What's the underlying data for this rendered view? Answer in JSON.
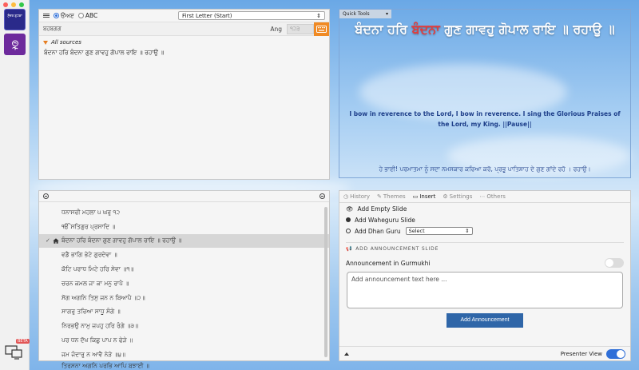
{
  "search": {
    "script_options": [
      "ੳਅੲ",
      "ABC"
    ],
    "selected_script": "ੳਅੲ",
    "search_type": "First Letter (Start)",
    "query": "ਬਹਬਗਗ",
    "ang_label": "Ang",
    "ang_placeholder": "੧੨੩",
    "sources_label": "All sources",
    "results": [
      "ਬੰਦਨਾ ਹਰਿ ਬੰਦਨਾ ਗੁਣ ਗਾਵਹੁ ਗੋਪਾਲ ਰਾਇ ॥ ਰਹਾਉ ॥"
    ]
  },
  "shabad": {
    "lines": [
      "ਧਨਾਸਰੀ ਮਹਲਾ ੫ ਘਰੁ ੧੨",
      "ੴ ਸਤਿਗੁਰ ਪ੍ਰਸਾਦਿ ॥",
      "ਬੰਦਨਾ ਹਰਿ ਬੰਦਨਾ ਗੁਣ ਗਾਵਹੁ ਗੋਪਾਲ ਰਾਇ ॥ ਰਹਾਉ ॥",
      "ਵਡੈ ਭਾਗਿ ਭੇਟੇ ਗੁਰਦੇਵਾ ॥",
      "ਕੋਟਿ ਪਰਾਧ ਮਿਟੇ ਹਰਿ ਸੇਵਾ ॥੧॥",
      "ਚਰਨ ਕਮਲ ਜਾ ਕਾ ਮਨੁ ਰਾਪੈ ॥",
      "ਸੋਗ ਅਗਨਿ ਤਿਸੁ ਜਨ ਨ ਬਿਆਪੈ ॥੨॥",
      "ਸਾਗਰੁ ਤਰਿਆ ਸਾਧੂ ਸੰਗੇ ॥",
      "ਨਿਰਭਉ ਨਾਮੁ ਜਪਹੁ ਹਰਿ ਰੰਗੇ ॥੩॥",
      "ਪਰ ਧਨ ਦੋਖ ਕਿਛੁ ਪਾਪ ਨ ਫੇੜੇ ॥",
      "ਜਮ ਜੰਦਾਰੁ ਨ ਆਵੈ ਨੇੜੇ ॥੪॥",
      "ਤ੍ਰਿਸਨਾ ਅਗਨਿ ਪ੍ਰਭਿ ਆਪਿ ਬੁਝਾਈ ॥"
    ],
    "current_index": 2
  },
  "preview": {
    "quick_tools_label": "Quick Tools",
    "gurbani_parts": [
      {
        "text": "ਬੰਦਨਾ ਹਰਿ ",
        "highlight": false
      },
      {
        "text": "ਬੰਦਨਾ",
        "highlight": true
      },
      {
        "text": " ਗੁਣ ਗਾਵਹੁ ਗੋਪਾਲ ਰਾਇ ॥ ਰਹਾਉ ॥",
        "highlight": false
      }
    ],
    "translation": "I bow in reverence to the Lord, I bow in reverence. I sing the Glorious Praises of the Lord, my King. ||Pause||",
    "teeka": "ਹੇ ਭਾਈ! ਪਰਮਾਤਮਾ ਨੂੰ ਸਦਾ ਨਮਸਕਾਰ ਕਰਿਆ ਕਰੋ, ਪ੍ਰਭੂ ਪਾਤਿਸ਼ਾਹ ਦੇ ਗੁਣ ਗਾਂਦੇ ਰਹੋ । ਰਹਾਉ।"
  },
  "tools": {
    "tabs": [
      {
        "label": "History",
        "icon": "clock-icon",
        "active": false
      },
      {
        "label": "Themes",
        "icon": "brush-icon",
        "active": false
      },
      {
        "label": "Insert",
        "icon": "monitor-icon",
        "active": true
      },
      {
        "label": "Settings",
        "icon": "gear-icon",
        "active": false
      },
      {
        "label": "Others",
        "icon": "dots-icon",
        "active": false
      }
    ],
    "insert_empty": "Add Empty Slide",
    "insert_waheguru": "Add Waheguru Slide",
    "insert_dhan_guru": "Add Dhan Guru",
    "dhan_guru_select": "Select",
    "announcement_section": "ADD ANNOUNCEMENT SLIDE",
    "announcement_gurmukhi_label": "Announcement in Gurmukhi",
    "announcement_gurmukhi_on": false,
    "announcement_placeholder": "Add announcement text here ...",
    "add_announcement_label": "Add Announcement",
    "presenter_view_label": "Presenter View",
    "presenter_view_on": true
  },
  "rail": {
    "book_icon_text": "ਸੁੰਦਰ ਗੁਟਕਾ",
    "beta_label": "BETA"
  },
  "colors": {
    "accent_orange": "#f08a24",
    "accent_blue": "#2f66a8",
    "gurbani_highlight": "#e23b3b",
    "translation_color": "#1e3f8a"
  }
}
